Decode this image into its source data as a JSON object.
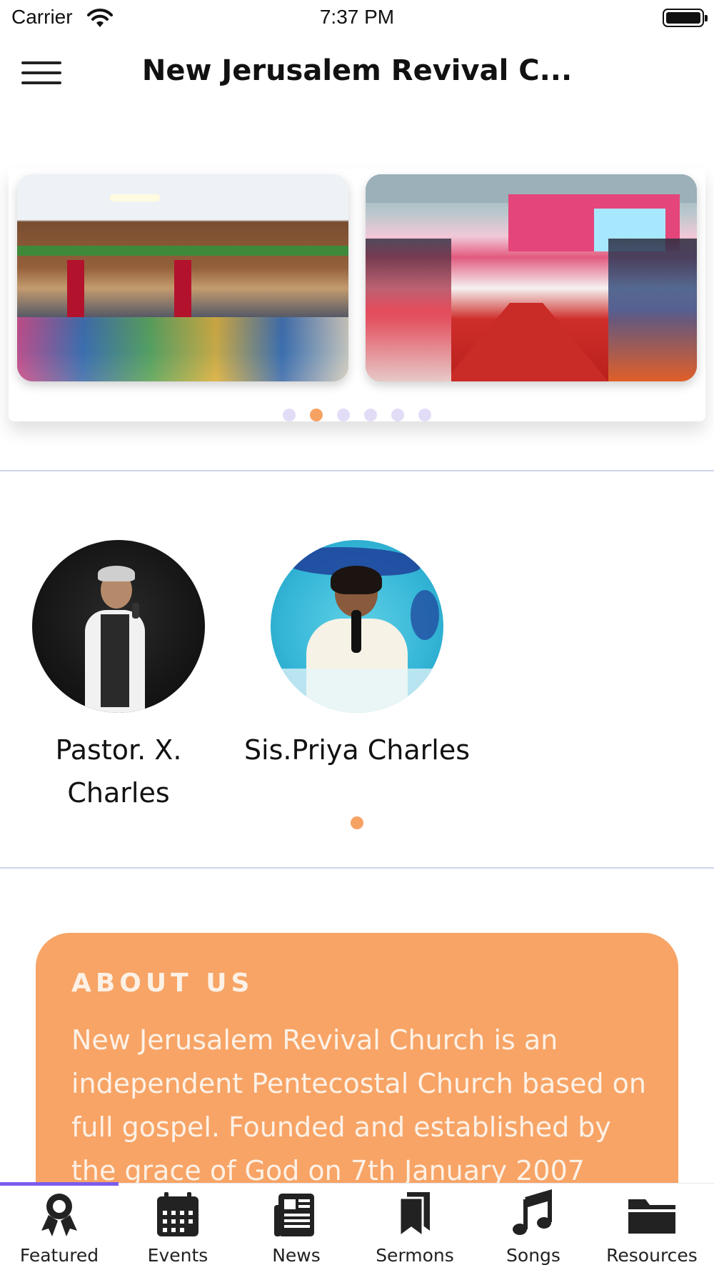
{
  "status_bar": {
    "carrier": "Carrier",
    "time": "7:37 PM"
  },
  "nav": {
    "title": "New Jerusalem Revival C..."
  },
  "carousel": {
    "slide_count": 6,
    "active_index": 1
  },
  "people": [
    {
      "name": "Pastor. X. Charles"
    },
    {
      "name": "Sis.Priya Charles"
    }
  ],
  "about": {
    "title": "ABOUT US",
    "body": "New Jerusalem Revival Church is an independent Pentecostal Church based on full gospel. Founded and established by the grace of God on 7th January 2007"
  },
  "tabs": [
    {
      "label": "Featured",
      "icon": "award-icon",
      "active": true
    },
    {
      "label": "Events",
      "icon": "calendar-icon"
    },
    {
      "label": "News",
      "icon": "newspaper-icon"
    },
    {
      "label": "Sermons",
      "icon": "bookmarks-icon"
    },
    {
      "label": "Songs",
      "icon": "music-note-icon"
    },
    {
      "label": "Resources",
      "icon": "folder-icon"
    }
  ],
  "colors": {
    "accent": "#f7a466",
    "active_dot": "#f6a263",
    "inactive_dot": "#e2dcf7",
    "tab_indicator": "#7b5cf0"
  }
}
